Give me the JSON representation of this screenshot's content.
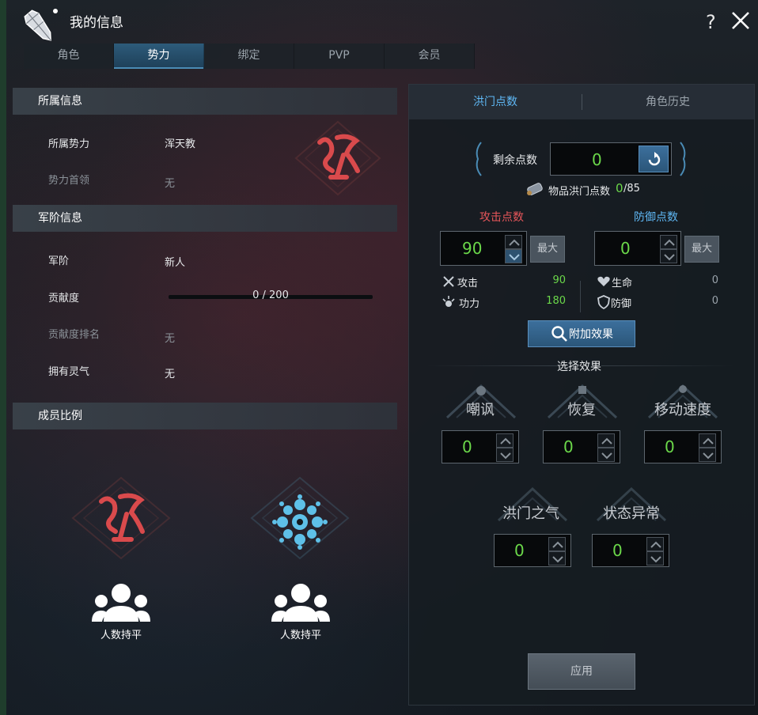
{
  "window": {
    "title": "我的信息"
  },
  "tabs": [
    {
      "label": "角色"
    },
    {
      "label": "势力"
    },
    {
      "label": "绑定"
    },
    {
      "label": "PVP"
    },
    {
      "label": "会员"
    }
  ],
  "active_tab": "势力",
  "affiliation": {
    "header": "所属信息",
    "faction_label": "所属势力",
    "faction_value": "浑天教",
    "leader_label": "势力首领",
    "leader_value": "无"
  },
  "rank": {
    "header": "军阶信息",
    "rank_label": "军阶",
    "rank_value": "新人",
    "contribution_label": "贡献度",
    "contribution_text": "0 / 200",
    "contribution_fraction": 0,
    "ranking_label": "贡献度排名",
    "ranking_value": "无",
    "aura_label": "拥有灵气",
    "aura_value": "无"
  },
  "members": {
    "header": "成员比例",
    "left_status": "人数持平",
    "right_status": "人数持平"
  },
  "points_panel": {
    "tab_points": "洪门点数",
    "tab_history": "角色历史",
    "remaining_label": "剩余点数",
    "remaining_value": "0",
    "item_points_label": "物品洪门点数",
    "item_points_current": "0",
    "item_points_total": "/85",
    "attack_header": "攻击点数",
    "attack_value": "90",
    "defense_header": "防御点数",
    "defense_value": "0",
    "max_label": "最大",
    "stats": {
      "attack_label": "攻击",
      "attack_value": "90",
      "power_label": "功力",
      "power_value": "180",
      "life_label": "生命",
      "life_value": "0",
      "defense_label": "防御",
      "defense_value": "0"
    },
    "extra_effects_button": "附加效果",
    "select_effects_label": "选择效果",
    "effects": [
      {
        "name": "嘲讽",
        "value": "0"
      },
      {
        "name": "恢复",
        "value": "0"
      },
      {
        "name": "移动速度",
        "value": "0"
      },
      {
        "name": "洪门之气",
        "value": "0"
      },
      {
        "name": "状态异常",
        "value": "0"
      }
    ],
    "apply_button": "应用"
  },
  "colors": {
    "accent_blue": "#5fb8f5",
    "attack_red": "#e8565a",
    "defense_blue": "#5fb8f5",
    "value_green": "#6bd84a",
    "faction_red": "#d94a4c",
    "faction_cyan": "#5ec0e8"
  },
  "icons": {
    "app_logo": "crystal-shard-icon",
    "help": "question-mark-icon",
    "close": "close-icon",
    "reset": "reset-icon",
    "item_points": "scroll-item-icon",
    "attack": "crossed-swords-icon",
    "power": "burst-icon",
    "life": "heart-icon",
    "defense": "shield-icon",
    "magnifier": "search-icon",
    "members": "people-group-icon"
  }
}
